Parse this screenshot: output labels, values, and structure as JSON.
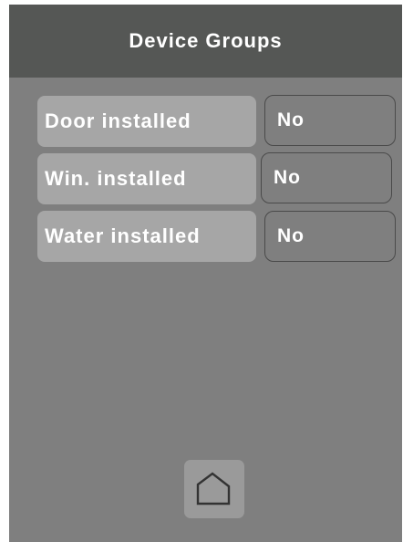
{
  "header": {
    "title": "Device Groups"
  },
  "rows": [
    {
      "label": "Door installed",
      "value": "No"
    },
    {
      "label": "Win. installed",
      "value": "No"
    },
    {
      "label": "Water installed",
      "value": "No"
    }
  ],
  "footer": {
    "home_icon": "home-icon"
  },
  "colors": {
    "header_background": "#555755",
    "screen_background": "#7f7f7f",
    "label_background": "#a6a6a6",
    "value_border": "#4a4a4a",
    "text": "#ffffff"
  }
}
